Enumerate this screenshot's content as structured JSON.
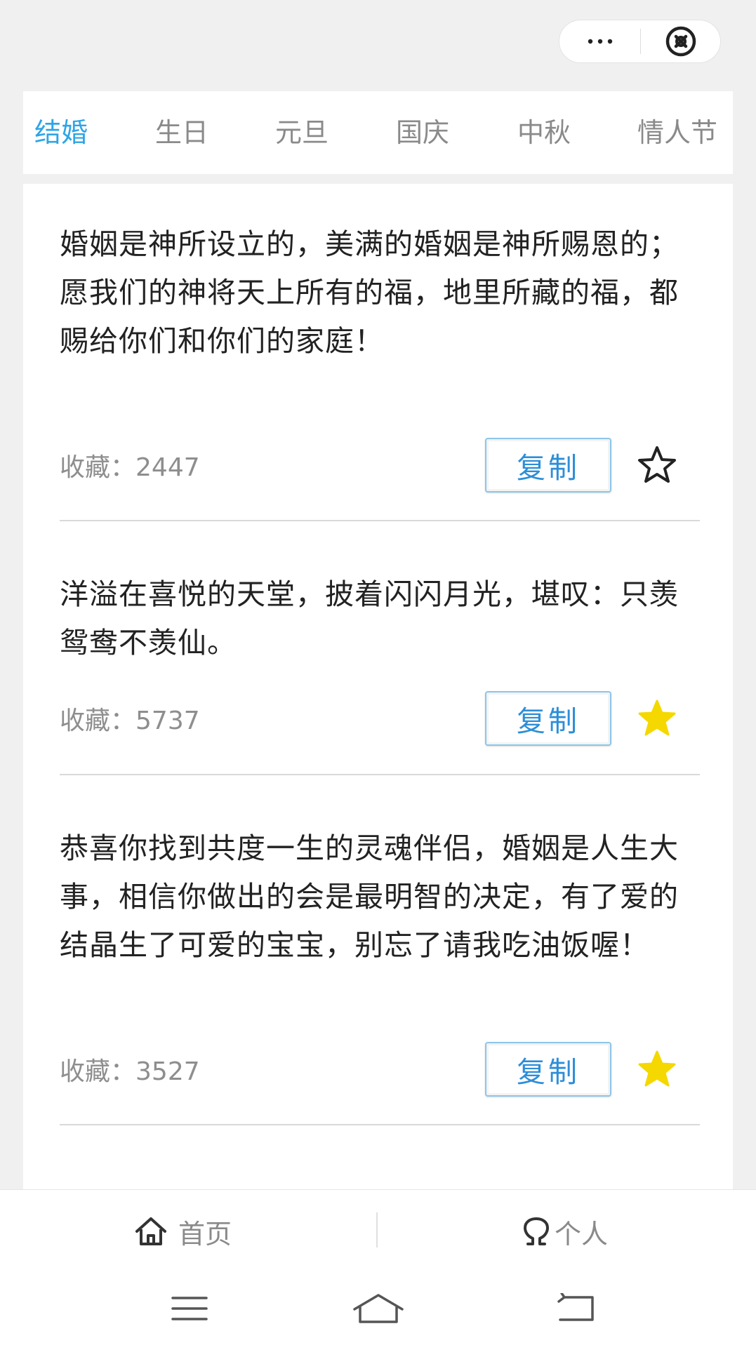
{
  "capsule": {
    "more_icon": "more-dots-icon",
    "close_icon": "close-circle-icon"
  },
  "tabs": [
    {
      "label": "结婚",
      "active": true
    },
    {
      "label": "生日",
      "active": false
    },
    {
      "label": "元旦",
      "active": false
    },
    {
      "label": "国庆",
      "active": false
    },
    {
      "label": "中秋",
      "active": false
    },
    {
      "label": "情人节",
      "active": false
    }
  ],
  "items": [
    {
      "text": "婚姻是神所设立的，美满的婚姻是神所赐恩的；愿我们的神将天上所有的福，地里所藏的福，都赐给你们和你们的家庭！",
      "fav_label": "收藏：",
      "fav_count": "2447",
      "copy_label": "复制",
      "starred": false
    },
    {
      "text": "洋溢在喜悦的天堂，披着闪闪月光，堪叹：只羡鸳鸯不羡仙。",
      "fav_label": "收藏：",
      "fav_count": "5737",
      "copy_label": "复制",
      "starred": true
    },
    {
      "text": "恭喜你找到共度一生的灵魂伴侣，婚姻是人生大事，相信你做出的会是最明智的决定，有了爱的结晶生了可爱的宝宝，别忘了请我吃油饭喔！",
      "fav_label": "收藏：",
      "fav_count": "3527",
      "copy_label": "复制",
      "starred": true
    }
  ],
  "tabbar": {
    "home_label": "首页",
    "profile_label": "个人"
  },
  "colors": {
    "accent": "#2ea5e6",
    "star_filled": "#f5d800",
    "button_text": "#2d8ed8"
  }
}
